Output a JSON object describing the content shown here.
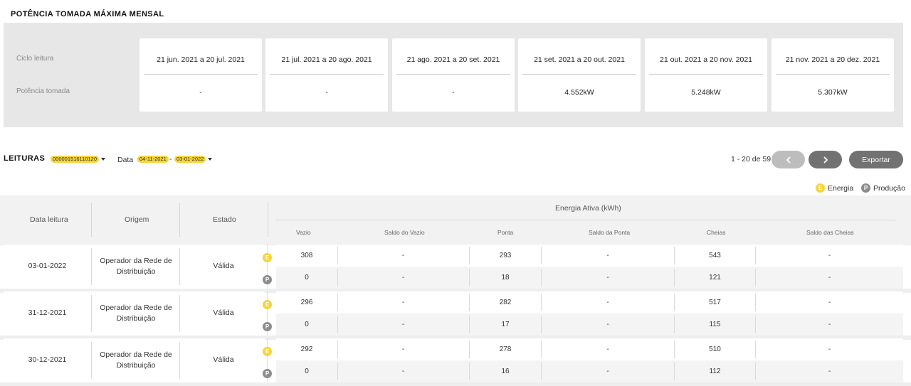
{
  "max_power": {
    "title": "POTÊNCIA TOMADA MÁXIMA MENSAL",
    "row_labels": [
      "Ciclo leitura",
      "Potência tomada"
    ],
    "cycles": [
      {
        "period": "21 jun. 2021 a 20 jul. 2021",
        "value": "-"
      },
      {
        "period": "21 jul. 2021 a 20 ago. 2021",
        "value": "-"
      },
      {
        "period": "21 ago. 2021 a 20 set. 2021",
        "value": "-"
      },
      {
        "period": "21 set. 2021 a 20 out. 2021",
        "value": "4.552kW"
      },
      {
        "period": "21 out. 2021 a 20 nov. 2021",
        "value": "5.248kW"
      },
      {
        "period": "21 nov. 2021 a 20 dez. 2021",
        "value": "5.307kW"
      }
    ]
  },
  "readings": {
    "title": "LEITURAS",
    "meter_id": "000001516110120",
    "date_label": "Data",
    "date_from": "04-11-2021",
    "date_sep": "-",
    "date_to": "03-01-2022",
    "pagination": "1 - 20 de 59",
    "export_label": "Exportar",
    "legend": {
      "energy_letter": "E",
      "energy_label": "Energia",
      "production_letter": "P",
      "production_label": "Produção"
    },
    "colors": {
      "energy": "#f5d53a",
      "production": "#8d8d8d",
      "button": "#727272"
    },
    "table": {
      "headers": {
        "date": "Data leitura",
        "origin": "Origem",
        "state": "Estado",
        "energy_group": "Energia Ativa (kWh)"
      },
      "sub_headers": [
        "Vazio",
        "Saldo do Vazio",
        "Ponta",
        "Saldo da Ponta",
        "Cheias",
        "Saldo das Cheias"
      ],
      "rows": [
        {
          "date": "03-01-2022",
          "origin_line1": "Operador da Rede de",
          "origin_line2": "Distribuição",
          "state": "Válida",
          "energy": [
            "308",
            "-",
            "293",
            "-",
            "543",
            "-"
          ],
          "production": [
            "0",
            "-",
            "18",
            "-",
            "121",
            "-"
          ]
        },
        {
          "date": "31-12-2021",
          "origin_line1": "Operador da Rede de",
          "origin_line2": "Distribuição",
          "state": "Válida",
          "energy": [
            "296",
            "-",
            "282",
            "-",
            "517",
            "-"
          ],
          "production": [
            "0",
            "-",
            "17",
            "-",
            "115",
            "-"
          ]
        },
        {
          "date": "30-12-2021",
          "origin_line1": "Operador da Rede de",
          "origin_line2": "Distribuição",
          "state": "Válida",
          "energy": [
            "292",
            "-",
            "278",
            "-",
            "510",
            "-"
          ],
          "production": [
            "0",
            "-",
            "16",
            "-",
            "112",
            "-"
          ]
        }
      ]
    }
  }
}
